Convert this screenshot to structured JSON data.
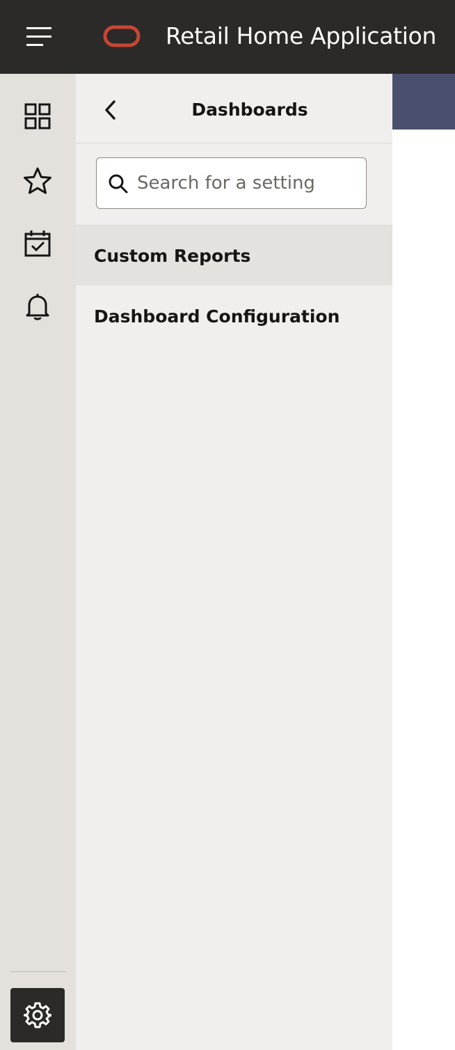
{
  "header": {
    "menu_icon": "hamburger-menu-icon",
    "logo_icon": "oracle-logo",
    "app_title": "Retail Home Application"
  },
  "rail": {
    "items": [
      {
        "icon": "dashboard-grid-icon",
        "label": "Dashboards"
      },
      {
        "icon": "star-icon",
        "label": "Favorites"
      },
      {
        "icon": "calendar-check-icon",
        "label": "Tasks"
      },
      {
        "icon": "bell-icon",
        "label": "Notifications"
      }
    ],
    "settings_icon": "gear-icon"
  },
  "panel": {
    "back_icon": "chevron-left-icon",
    "title": "Dashboards",
    "search": {
      "placeholder": "Search for a setting",
      "value": ""
    },
    "items": [
      {
        "label": "Custom Reports",
        "selected": true
      },
      {
        "label": "Dashboard Configuration",
        "selected": false
      }
    ]
  },
  "colors": {
    "header_bg": "#2b2a28",
    "logo": "#c74634",
    "rail_bg": "#e4e1dc",
    "panel_bg": "#f1efed",
    "selected_bg": "#e4e2df",
    "accent": "#4a4f6e"
  }
}
